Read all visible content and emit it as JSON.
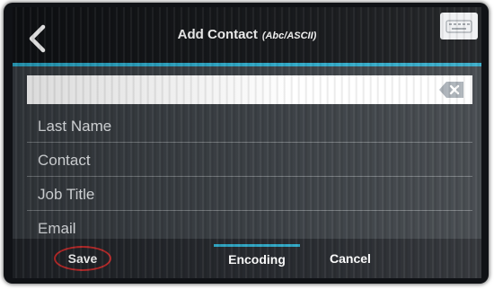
{
  "header": {
    "title": "Add Contact",
    "subtitle": "(Abc/ASCII)"
  },
  "input": {
    "value": ""
  },
  "fields": [
    {
      "label": "Last Name"
    },
    {
      "label": "Contact"
    },
    {
      "label": "Job Title"
    },
    {
      "label": "Email"
    }
  ],
  "footer": {
    "save_label": "Save",
    "encoding_label": "Encoding",
    "cancel_label": "Cancel"
  },
  "colors": {
    "accent": "#29a5c4",
    "save_highlight": "#c52a2a"
  },
  "icons": {
    "back": "chevron-left-icon",
    "keyboard": "keyboard-icon",
    "clear": "backspace-icon"
  }
}
